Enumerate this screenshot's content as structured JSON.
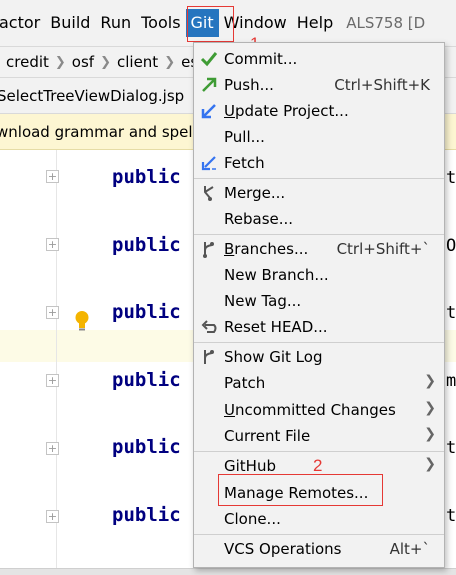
{
  "menubar": {
    "items": [
      "actor",
      "Build",
      "Run",
      "Tools",
      "Git",
      "Window",
      "Help"
    ],
    "title": "ALS758 [D"
  },
  "breadcrumb": [
    "credit",
    "osf",
    "client",
    "esb"
  ],
  "tab": {
    "filename": "SelectTreeViewDialog.jsp"
  },
  "notification": {
    "text": "wnload grammar and spellin"
  },
  "editor": {
    "keyword": "public",
    "line_tails": [
      "t",
      "O",
      "t",
      "m",
      "t",
      "t"
    ]
  },
  "callouts": [
    "1",
    "2"
  ],
  "git_menu": {
    "items": [
      {
        "mnemonic": "",
        "rest": "Commit...",
        "shortcut": "",
        "icon": "check-icon",
        "color": "#3f9c35"
      },
      {
        "mnemonic": "",
        "rest": "Push...",
        "shortcut": "Ctrl+Shift+K",
        "icon": "push-arrow-icon",
        "color": "#3f9c35"
      },
      {
        "mnemonic": "U",
        "rest": "pdate Project...",
        "shortcut": "",
        "icon": "update-arrow-icon",
        "color": "#3574f0"
      },
      {
        "mnemonic": "",
        "rest": "Pull...",
        "shortcut": "",
        "icon": "",
        "color": ""
      },
      {
        "mnemonic": "",
        "rest": "Fetch",
        "shortcut": "",
        "icon": "fetch-icon",
        "color": "#3574f0"
      },
      {
        "mnemonic": "",
        "rest": "Merge...",
        "shortcut": "",
        "icon": "merge-icon",
        "color": "#555555"
      },
      {
        "mnemonic": "",
        "rest": "Rebase...",
        "shortcut": "",
        "icon": "",
        "color": ""
      },
      {
        "mnemonic": "B",
        "rest": "ranches...",
        "shortcut": "Ctrl+Shift+`",
        "icon": "branch-icon",
        "color": "#555555"
      },
      {
        "mnemonic": "",
        "rest": "New Branch...",
        "shortcut": "",
        "icon": "",
        "color": ""
      },
      {
        "mnemonic": "",
        "rest": "New Tag...",
        "shortcut": "",
        "icon": "",
        "color": ""
      },
      {
        "mnemonic": "",
        "rest": "Reset HEAD...",
        "shortcut": "",
        "icon": "reset-icon",
        "color": "#555555"
      },
      {
        "mnemonic": "",
        "rest": "Show Git Log",
        "shortcut": "",
        "icon": "git-log-icon",
        "color": "#555555"
      },
      {
        "mnemonic": "",
        "rest": "Patch",
        "shortcut": "",
        "icon": "",
        "color": ""
      },
      {
        "mnemonic": "U",
        "rest": "ncommitted Changes",
        "shortcut": "",
        "icon": "",
        "color": ""
      },
      {
        "mnemonic": "",
        "rest": "Current File",
        "shortcut": "",
        "icon": "",
        "color": ""
      },
      {
        "mnemonic": "",
        "rest": "GitHub",
        "shortcut": "",
        "icon": "",
        "color": ""
      },
      {
        "mnemonic": "",
        "rest": "Manage Remotes...",
        "shortcut": "",
        "icon": "",
        "color": ""
      },
      {
        "mnemonic": "",
        "rest": "Clone...",
        "shortcut": "",
        "icon": "",
        "color": ""
      },
      {
        "mnemonic": "",
        "rest": "VCS Operations",
        "shortcut": "Alt+`",
        "icon": "",
        "color": ""
      }
    ]
  },
  "colors": {
    "menu_highlight": "#2675bf",
    "annotation_red": "#e53935",
    "keyword_navy": "#000080"
  }
}
